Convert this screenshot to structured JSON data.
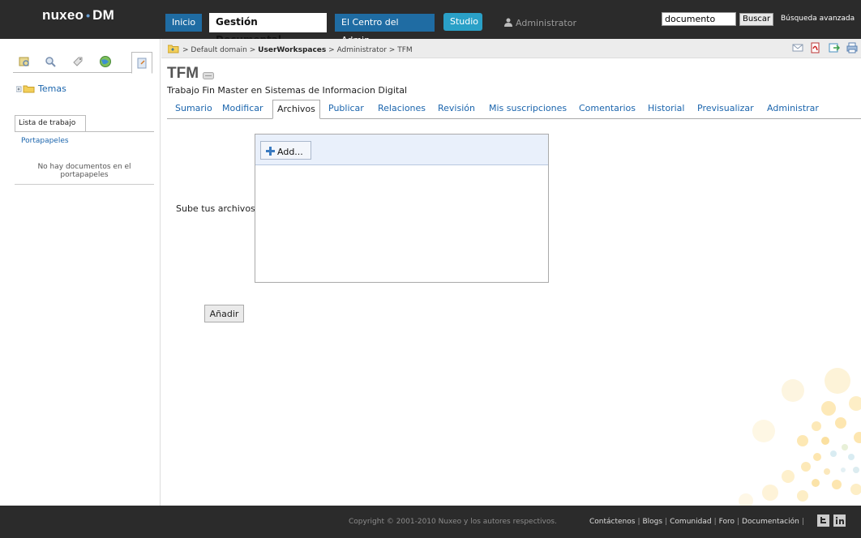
{
  "header": {
    "logo_main": "nuxeo",
    "logo_sep": "•",
    "logo_product": "DM",
    "nav": {
      "inicio": "Inicio",
      "gestion": "Gestión Documental",
      "admin": "El Centro del Admin",
      "studio": "Studio"
    },
    "user": "Administrator",
    "search": {
      "value": "documento",
      "button": "Buscar"
    },
    "advanced_search": "Búsqueda avanzada"
  },
  "sidebar": {
    "tree_item": "Temas",
    "worklist_tab": "Lista de trabajo",
    "clipboard_label": "Portapapeles",
    "clipboard_empty": "No hay documentos en el portapapeles"
  },
  "breadcrumb": {
    "items": [
      "Default domain",
      "UserWorkspaces",
      "Administrator",
      "TFM"
    ],
    "separator": ">"
  },
  "document": {
    "title": "TFM",
    "description": "Trabajo Fin Master en Sistemas de Informacion Digital"
  },
  "tabs": [
    "Sumario",
    "Modificar",
    "Archivos",
    "Publicar",
    "Relaciones",
    "Revisión",
    "Mis suscripciones",
    "Comentarios",
    "Historial",
    "Previsualizar",
    "Administrar"
  ],
  "active_tab": "Archivos",
  "upload": {
    "label": "Sube tus archivos",
    "add_button": "Add...",
    "submit_button": "Añadir"
  },
  "footer": {
    "copyright": "Copyright © 2001-2010 Nuxeo y los autores respectivos.",
    "links": [
      "Contáctenos",
      "Blogs",
      "Comunidad",
      "Foro",
      "Documentación"
    ],
    "separator": "|"
  },
  "colors": {
    "topbar": "#2b2b2b",
    "nav_blue": "#1f6ca3",
    "studio": "#2aa0c7",
    "link": "#1b65ad"
  }
}
